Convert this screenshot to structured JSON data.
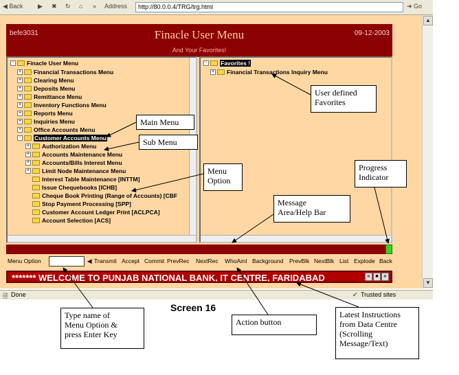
{
  "browser": {
    "back_label": "Back",
    "address_label": "Address",
    "url": "http://80.0.0.4/TRG/trg.html",
    "go_label": "Go",
    "status_done": "Done",
    "status_zone": "Trusted sites"
  },
  "header": {
    "user": "befe3031",
    "title": "Finacle User Menu",
    "subtitle": "And Your Favorites!",
    "date": "09-12-2003"
  },
  "left_tree": [
    {
      "label": "Finacle User Menu",
      "sign": "-"
    },
    {
      "label": "Financial Transactions Menu",
      "sign": "+"
    },
    {
      "label": "Clearing Menu",
      "sign": "+"
    },
    {
      "label": "Deposits Menu",
      "sign": "+"
    },
    {
      "label": "Remittance Menu",
      "sign": "+"
    },
    {
      "label": "Inventory Functions Menu",
      "sign": "+"
    },
    {
      "label": "Reports Menu",
      "sign": "+"
    },
    {
      "label": "Inquiries Menu",
      "sign": "+"
    },
    {
      "label": "Office Accounts Menu",
      "sign": "+"
    },
    {
      "label": "Customer Accounts Menu",
      "sign": "-"
    },
    {
      "label": "Authorization Menu",
      "sign": "+"
    },
    {
      "label": "Accounts Maintenance Menu",
      "sign": "+"
    },
    {
      "label": "Accounts/Bills Interest Menu",
      "sign": "+"
    },
    {
      "label": "Limit Node Maintenance Menu",
      "sign": "+"
    },
    {
      "label": "Interest Table Maintenance [INTTM]",
      "sign": ""
    },
    {
      "label": "Issue Chequebooks [ICHB]",
      "sign": ""
    },
    {
      "label": "Cheque Book Printing (Range of Accounts) [CBF",
      "sign": ""
    },
    {
      "label": "Stop Payment Processing [SPP]",
      "sign": ""
    },
    {
      "label": "Customer Account Ledger Print [ACLPCA]",
      "sign": ""
    },
    {
      "label": "Account Selection [ACS]",
      "sign": ""
    }
  ],
  "right_tree": [
    {
      "label": "Favorites !",
      "sign": "-"
    },
    {
      "label": "Financial Transactions Inquiry Menu",
      "sign": "+"
    }
  ],
  "action_bar": {
    "menu_option_label": "Menu Option",
    "buttons": [
      "Transmit",
      "Accept",
      "Commit",
      "PrevRec",
      "NextRec",
      "WhoAmI",
      "Background",
      "PrevBlk",
      "NextBlk",
      "List",
      "Explode",
      "Back"
    ]
  },
  "welcome_text": "******* WELCOME TO PUNJAB NATIONAL BANK, IT CENTRE, FARIDABAD",
  "annotations": {
    "main_menu": "Main Menu",
    "sub_menu": "Sub Menu",
    "menu_option": "Menu\nOption",
    "user_favorites": "User defined\nFavorites",
    "progress": "Progress\nIndicator",
    "message_area": "Message\nArea/Help Bar",
    "type_name": "Type name of\nMenu Option &\npress Enter Key",
    "action_button": "Action button",
    "latest_instructions": "Latest Instructions\nfrom Data Centre\n(Scrolling\nMessage/Text)"
  },
  "screen_label": "Screen 16",
  "colors": {
    "header_bg": "#8b0000",
    "page_bg": "#ffd7a3",
    "progress": "#3bd11b"
  }
}
